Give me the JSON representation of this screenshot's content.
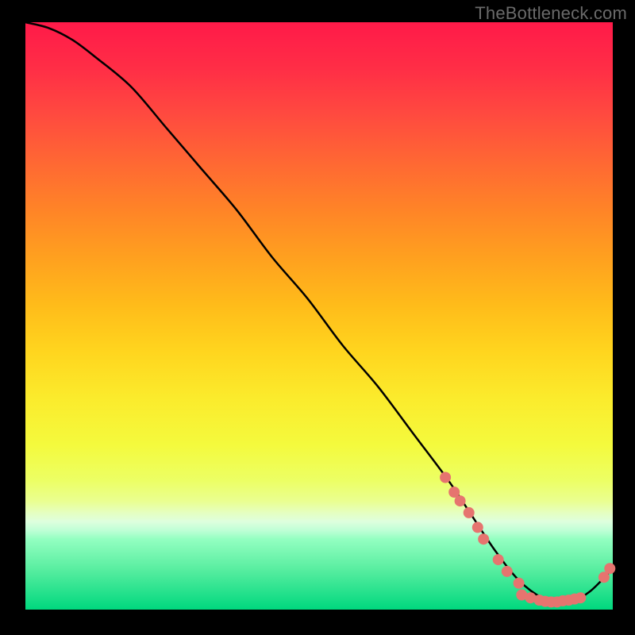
{
  "watermark": "TheBottleneck.com",
  "chart_data": {
    "type": "line",
    "title": "",
    "xlabel": "",
    "ylabel": "",
    "xlim": [
      0,
      100
    ],
    "ylim": [
      0,
      100
    ],
    "curve": {
      "x": [
        0,
        4,
        8,
        12,
        18,
        24,
        30,
        36,
        42,
        48,
        54,
        60,
        66,
        72,
        76,
        80,
        84,
        88,
        92,
        96,
        100
      ],
      "y": [
        100,
        99,
        97,
        94,
        89,
        82,
        75,
        68,
        60,
        53,
        45,
        38,
        30,
        22,
        16,
        10,
        5,
        2,
        1,
        3,
        7
      ]
    },
    "data_points": [
      {
        "x": 71.5,
        "y": 22.5
      },
      {
        "x": 73.0,
        "y": 20.0
      },
      {
        "x": 74.0,
        "y": 18.5
      },
      {
        "x": 75.5,
        "y": 16.5
      },
      {
        "x": 77.0,
        "y": 14.0
      },
      {
        "x": 78.0,
        "y": 12.0
      },
      {
        "x": 80.5,
        "y": 8.5
      },
      {
        "x": 82.0,
        "y": 6.5
      },
      {
        "x": 84.0,
        "y": 4.5
      },
      {
        "x": 84.5,
        "y": 2.5
      },
      {
        "x": 86.0,
        "y": 2.0
      },
      {
        "x": 87.5,
        "y": 1.6
      },
      {
        "x": 88.5,
        "y": 1.4
      },
      {
        "x": 89.5,
        "y": 1.3
      },
      {
        "x": 90.5,
        "y": 1.3
      },
      {
        "x": 91.5,
        "y": 1.5
      },
      {
        "x": 92.5,
        "y": 1.6
      },
      {
        "x": 93.5,
        "y": 1.8
      },
      {
        "x": 94.5,
        "y": 2.0
      },
      {
        "x": 98.5,
        "y": 5.5
      },
      {
        "x": 99.5,
        "y": 7.0
      }
    ],
    "point_radius": 7
  }
}
